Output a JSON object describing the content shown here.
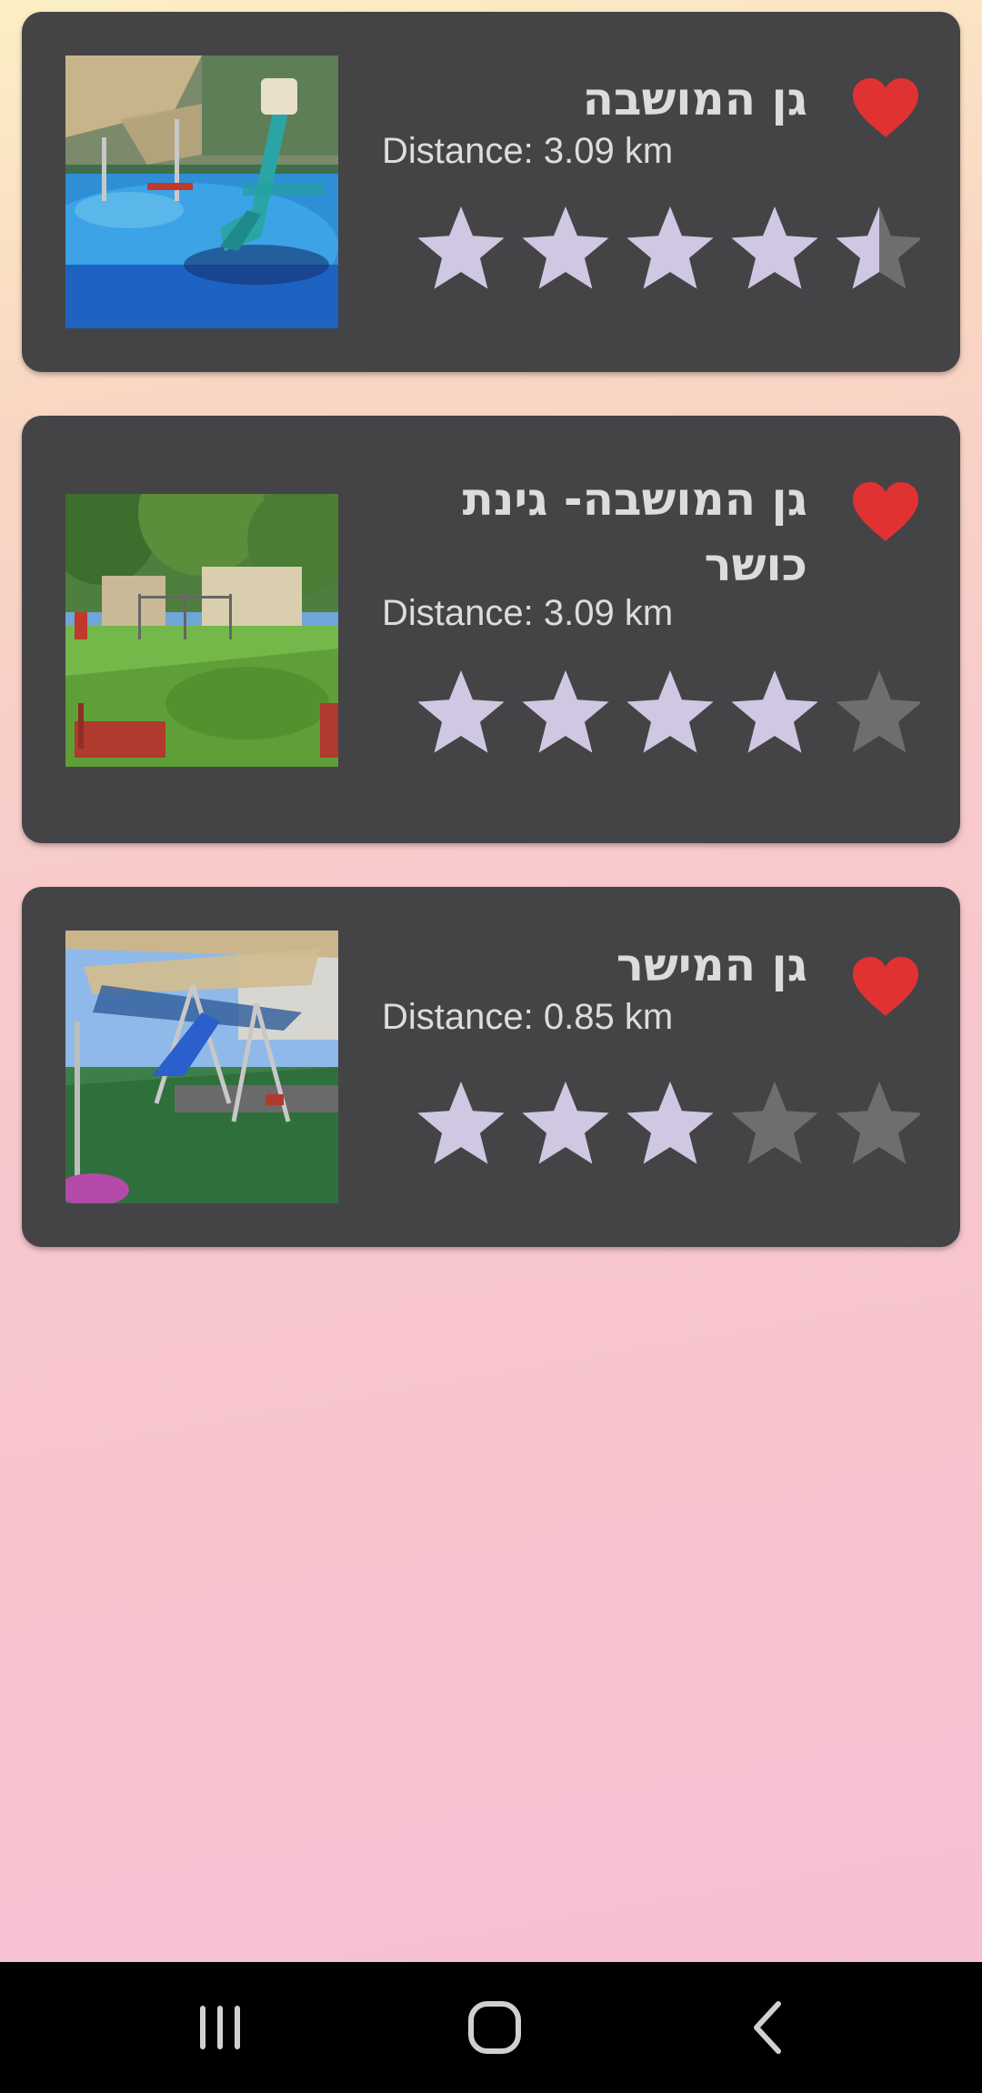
{
  "colors": {
    "card_bg": "#444446",
    "text": "#dcdcdc",
    "star_filled": "#d0c7e3",
    "star_empty": "#6e6e70",
    "heart": "#e03232",
    "navbar": "#000000"
  },
  "playgrounds": [
    {
      "name": "גן המושבה",
      "distance": "Distance: 3.09 km",
      "rating": 4.5,
      "favorite": true,
      "photo": "playground-photo-slide"
    },
    {
      "name": "גן המושבה- גינת כושר",
      "distance": "Distance: 3.09 km",
      "rating": 4,
      "favorite": true,
      "photo": "playground-photo-fitness-park"
    },
    {
      "name": "גן המישר",
      "distance": "Distance: 0.85 km",
      "rating": 3,
      "favorite": true,
      "photo": "playground-photo-swings"
    }
  ],
  "navbar": {
    "buttons": [
      "recent-apps-icon",
      "home-icon",
      "back-icon"
    ]
  }
}
